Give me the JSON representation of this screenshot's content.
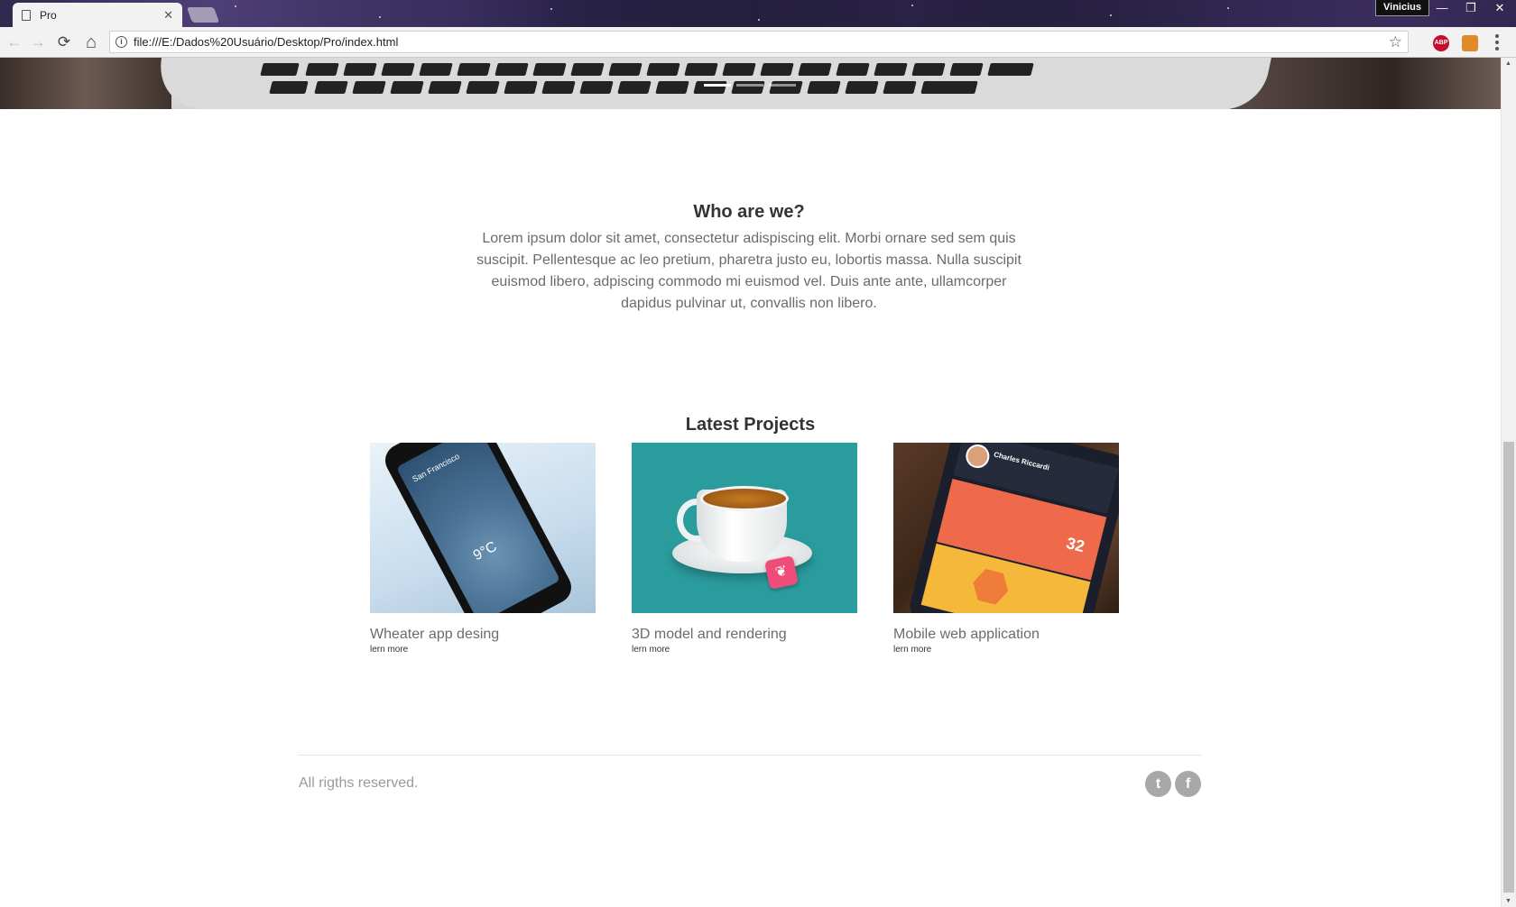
{
  "browser": {
    "tab_title": "Pro",
    "tab_close": "✕",
    "profile_name": "Vinicius",
    "window_buttons": [
      "—",
      "❐",
      "✕"
    ],
    "url": "file:///E:/Dados%20Usuário/Desktop/Pro/index.html",
    "nav": {
      "back": "←",
      "forward": "→",
      "reload": "⟳",
      "home": "⌂"
    },
    "extensions": [
      {
        "name": "adblock-plus-icon",
        "label": "ABP",
        "color": "#c70d2c"
      },
      {
        "name": "extension-icon",
        "label": "",
        "color": "#e08a2b"
      }
    ]
  },
  "carousel": {
    "slides": 3,
    "active_index": 0
  },
  "about": {
    "title": "Who are we?",
    "text": "Lorem ipsum dolor sit amet, consectetur adispiscing elit. Morbi ornare sed sem quis suscipit. Pellentesque ac leo pretium, pharetra justo eu, lobortis massa. Nulla suscipit euismod libero, adpiscing commodo mi euismod vel. Duis ante ante, ullamcorper dapidus pulvinar ut, convallis non libero."
  },
  "projects": {
    "title": "Latest Projects",
    "items": [
      {
        "title": "Wheater app desing",
        "link": "lern more",
        "image": {
          "city": "San Francisco",
          "temp": "9°C"
        }
      },
      {
        "title": "3D model and rendering",
        "link": "lern more"
      },
      {
        "title": "Mobile web application",
        "link": "lern more",
        "image": {
          "user": "Charles Riccardi",
          "number": "32"
        }
      }
    ]
  },
  "footer": {
    "copyright": "All rigths reserved.",
    "social": [
      {
        "name": "twitter-icon",
        "glyph": "t"
      },
      {
        "name": "facebook-icon",
        "glyph": "f"
      }
    ]
  },
  "colors": {
    "text_dark": "#333333",
    "text_muted": "#6b6b6b",
    "footer_text": "#9a9a9a",
    "social_bg": "#a8a8a8"
  }
}
